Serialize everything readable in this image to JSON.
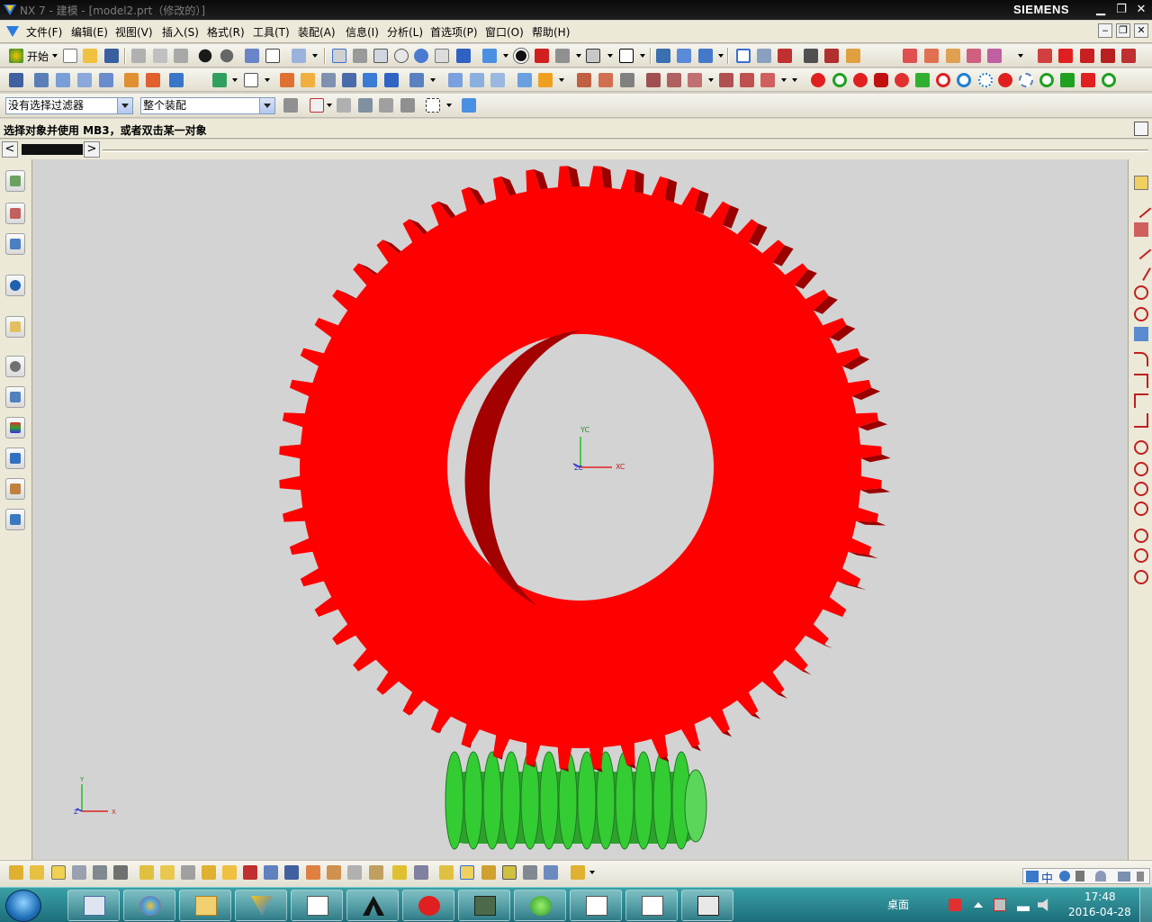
{
  "window": {
    "title": "NX 7 - 建模 - [model2.prt（修改的）]",
    "brand": "SIEMENS",
    "min": "▁",
    "restore": "❐",
    "close": "✕"
  },
  "menu": {
    "items": [
      "文件(F)",
      "编辑(E)",
      "视图(V)",
      "插入(S)",
      "格式(R)",
      "工具(T)",
      "装配(A)",
      "信息(I)",
      "分析(L)",
      "首选项(P)",
      "窗口(O)",
      "帮助(H)"
    ],
    "mdi_min": "‒",
    "mdi_restore": "❐",
    "mdi_close": "✕"
  },
  "toolbar": {
    "start_label": "开始"
  },
  "filter": {
    "type_filter": "没有选择过滤器",
    "scope": "整个装配"
  },
  "cue": {
    "message": "选择对象并使用 MB3，或者双击某一对象"
  },
  "nav": {
    "left": "<",
    "right": ">"
  },
  "viewport": {
    "wcs_x": "XC",
    "wcs_y": "YC",
    "wcs_z": "ZC",
    "abs_x": "X",
    "abs_y": "Y",
    "abs_z": "Z",
    "gear_color": "#ff0000",
    "worm_color": "#33cc33",
    "background": "#d3d3d3"
  },
  "taskbar": {
    "desktop_label": "桌面",
    "time": "17:48",
    "date": "2016-04-28"
  },
  "ime": {
    "label": "中"
  }
}
